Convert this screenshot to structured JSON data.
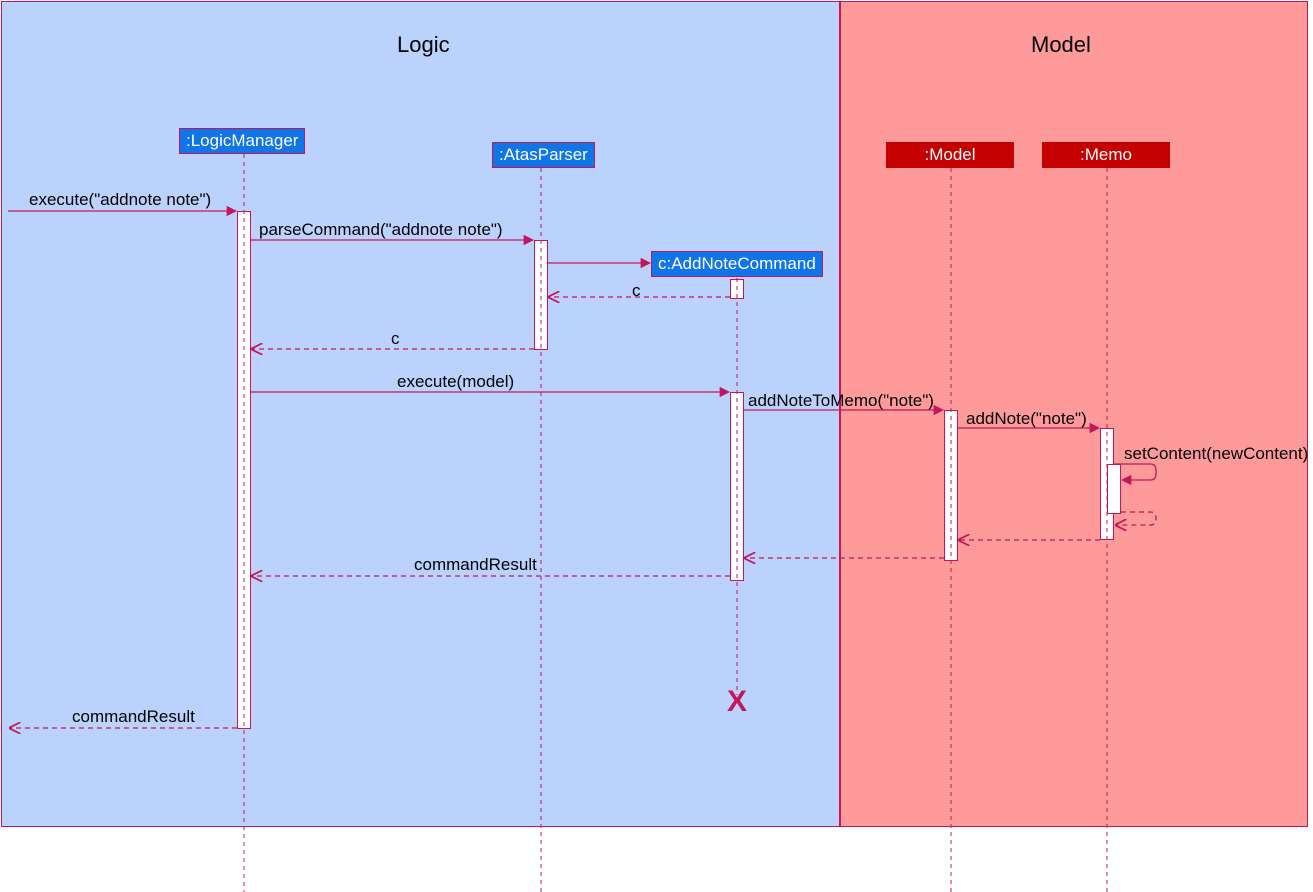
{
  "frames": {
    "logic": {
      "title": "Logic"
    },
    "model": {
      "title": "Model"
    }
  },
  "participants": {
    "logicManager": {
      "label": ":LogicManager"
    },
    "atasParser": {
      "label": ":AtasParser"
    },
    "addNoteCommand": {
      "label": "c:AddNoteCommand"
    },
    "model": {
      "label": ":Model"
    },
    "memo": {
      "label": ":Memo"
    }
  },
  "messages": {
    "m1": "execute(\"addnote note\")",
    "m2": "parseCommand(\"addnote note\")",
    "m3": "c",
    "m4": "c",
    "m5": "execute(model)",
    "m6": "addNoteToMemo(\"note\")",
    "m7": "addNote(\"note\")",
    "m8": "setContent(newContent)",
    "m9": "commandResult",
    "m10": "commandResult"
  },
  "colors": {
    "line": "#c2185b",
    "logicBg": "#bbd2fd",
    "modelBg": "#fe9a9a"
  }
}
